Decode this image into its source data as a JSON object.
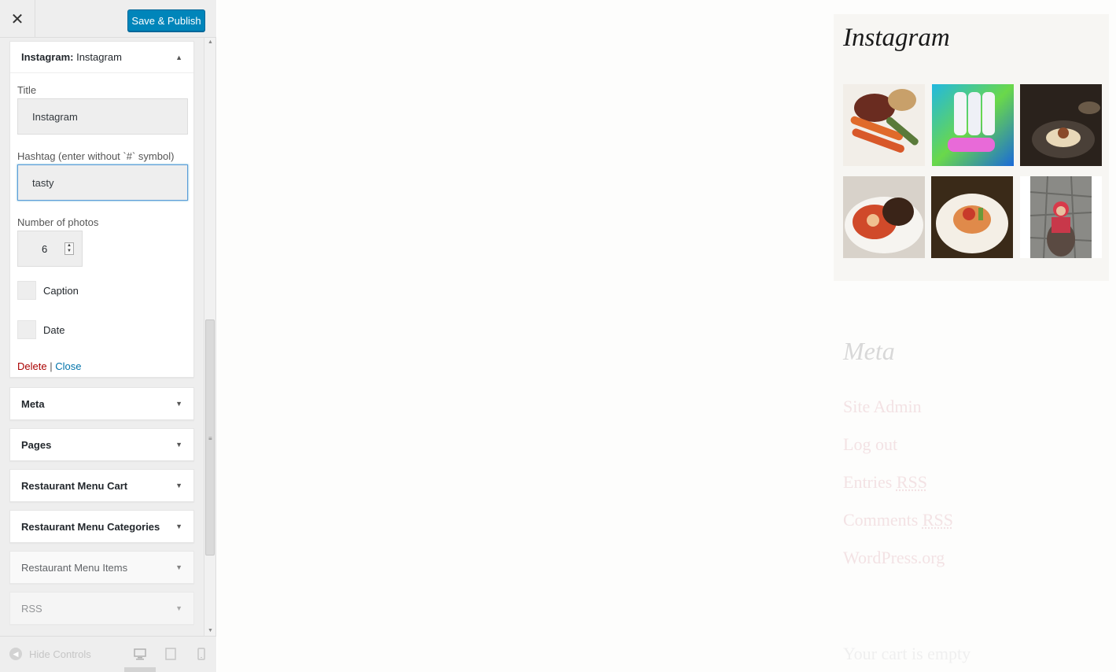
{
  "header": {
    "close_label": "✕",
    "publish_label": "Save & Publish"
  },
  "widget_open": {
    "title_prefix": "Instagram:",
    "title_name": "Instagram",
    "fields": {
      "title_label": "Title",
      "title_value": "Instagram",
      "hashtag_label": "Hashtag (enter without `#` symbol)",
      "hashtag_value": "tasty",
      "photos_label": "Number of photos",
      "photos_value": "6",
      "caption_label": "Caption",
      "date_label": "Date"
    },
    "actions": {
      "delete": "Delete",
      "separator": "|",
      "close": "Close"
    }
  },
  "widgets": [
    {
      "label": "Meta"
    },
    {
      "label": "Pages"
    },
    {
      "label": "Restaurant Menu Cart"
    },
    {
      "label": "Restaurant Menu Categories"
    },
    {
      "label": "Restaurant Menu Items"
    },
    {
      "label": "RSS"
    }
  ],
  "footer": {
    "hide_controls": "Hide Controls"
  },
  "preview": {
    "instagram_title": "Instagram",
    "photo_colors": [
      "#8a4a2a",
      "#3cc0d8",
      "#3a2a20",
      "#c44a2a",
      "#d87a4a",
      "#6a6a6a"
    ],
    "meta_title": "Meta",
    "meta_links": {
      "site_admin": "Site Admin",
      "log_out": "Log out",
      "entries": "Entries",
      "entries_rss": "RSS",
      "comments": "Comments",
      "comments_rss": "RSS",
      "wordpress": "WordPress.org"
    },
    "cart_empty": "Your cart is empty"
  }
}
